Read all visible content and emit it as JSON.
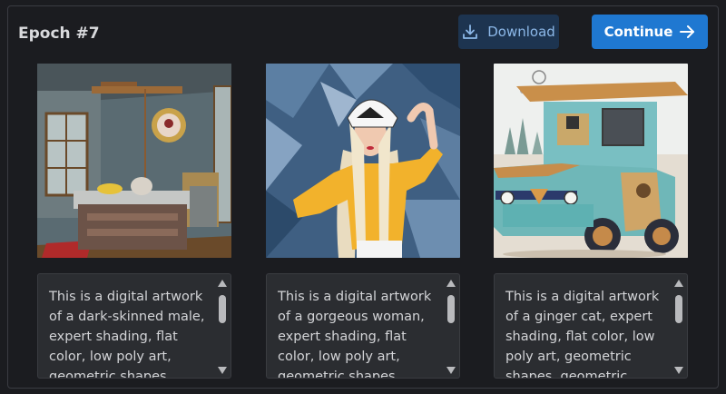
{
  "header": {
    "title": "Epoch #7",
    "download_label": "Download",
    "continue_label": "Continue"
  },
  "colors": {
    "accent": "#1f78d1",
    "download_bg": "#1d3450",
    "panel_bg": "#1b1c20",
    "textbox_bg": "#2b2d31"
  },
  "cards": [
    {
      "text": "This is a digital artwork of a dark-skinned male, expert shading, flat color, low poly art, geometric shapes, geometric"
    },
    {
      "text": "This is a digital artwork of a gorgeous woman, expert shading, flat color, low poly art, geometric shapes, geometric"
    },
    {
      "text": "This is a digital artwork of a ginger cat, expert shading, flat color, low poly art, geometric shapes, geometric"
    }
  ]
}
